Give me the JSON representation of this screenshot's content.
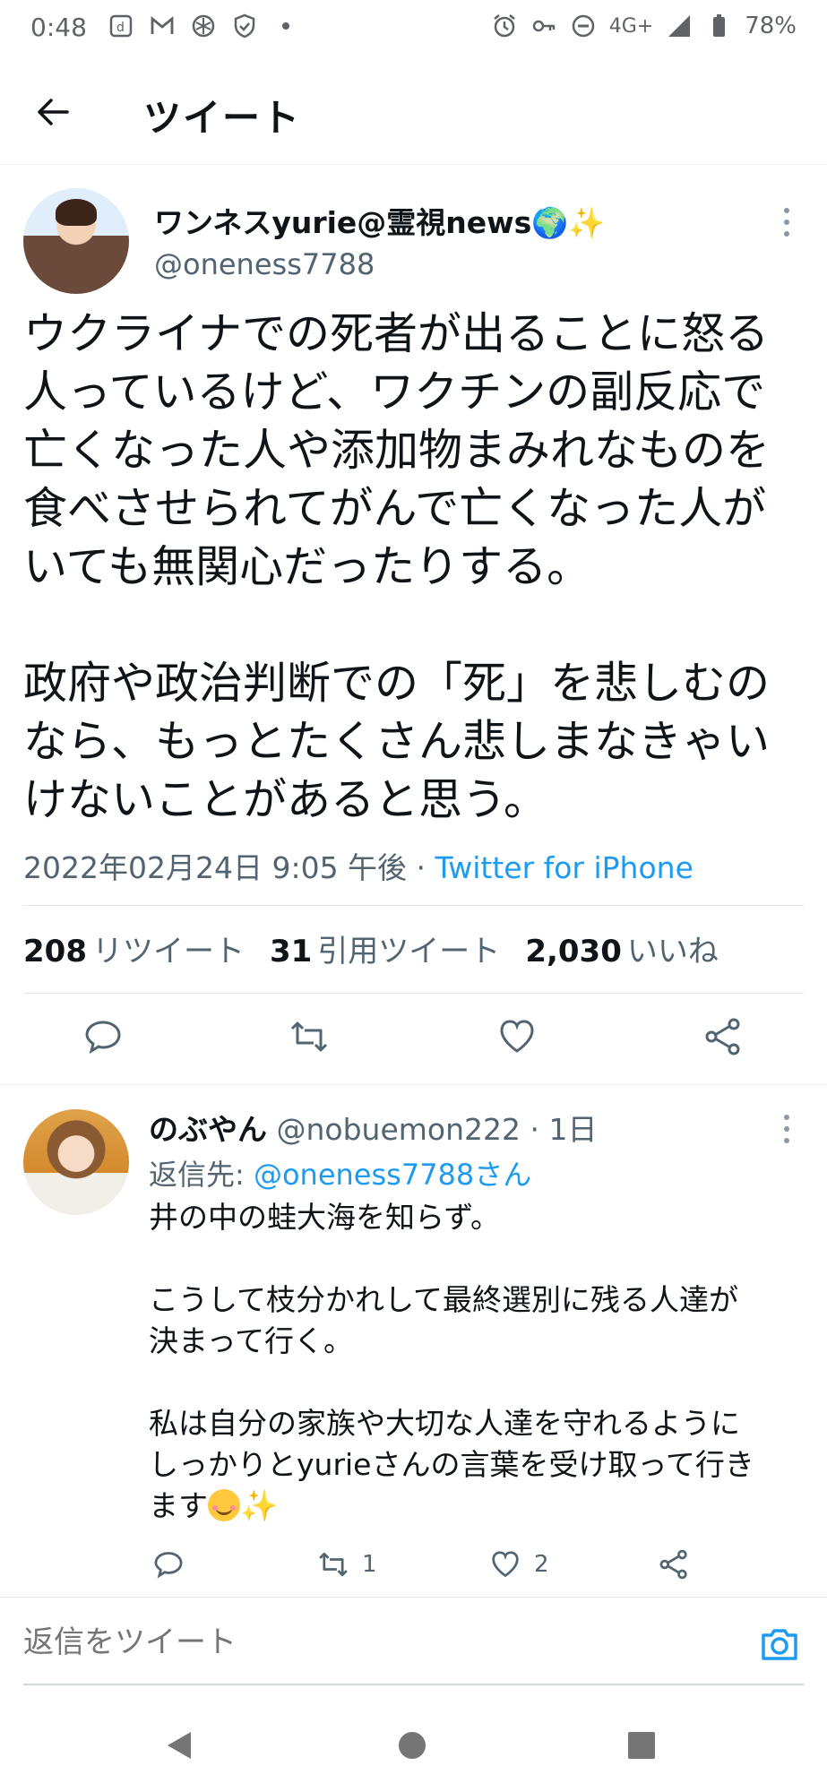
{
  "status_bar": {
    "time": "0:48",
    "left_icons": [
      "dictionary-icon",
      "gmail-icon",
      "app-icon",
      "shield-icon",
      "dot-icon"
    ],
    "network": "4G+",
    "battery": "78%"
  },
  "header": {
    "title": "ツイート"
  },
  "tweet": {
    "author_name": "ワンネスyurie@霊視news🌍✨",
    "author_handle": "@oneness7788",
    "text": "ウクライナでの死者が出ることに怒る\n人っているけど、ワクチンの副反応で\n亡くなった人や添加物まみれなものを\n食べさせられてがんで亡くなった人が\nいても無関心だったりする。\n\n政府や政治判断での「死」を悲しむの\nなら、もっとたくさん悲しまなきゃい\nけないことがあると思う。",
    "timestamp": "2022年02月24日 9:05 午後 · ",
    "source": "Twitter for iPhone",
    "stats": {
      "retweets_count": "208",
      "retweets_label": "リツイート",
      "quotes_count": "31",
      "quotes_label": "引用ツイート",
      "likes_count": "2,030",
      "likes_label": "いいね"
    }
  },
  "reply": {
    "author_name": "のぶやん",
    "author_handle": "@nobuemon222 · 1日",
    "reply_to_label": "返信先: ",
    "reply_to_mention": "@oneness7788さん",
    "text": "井の中の蛙大海を知らず。\n\nこうして枝分かれして最終選別に残る人達が\n決まって行く。\n\n私は自分の家族や大切な人達を守れるように\nしっかりとyurieさんの言葉を受け取って行き\nます",
    "retweet_count": "1",
    "like_count": "2"
  },
  "compose": {
    "placeholder": "返信をツイート"
  },
  "colors": {
    "accent": "#1d9bf0",
    "secondary_text": "#536471",
    "primary_text": "#0f1419"
  }
}
